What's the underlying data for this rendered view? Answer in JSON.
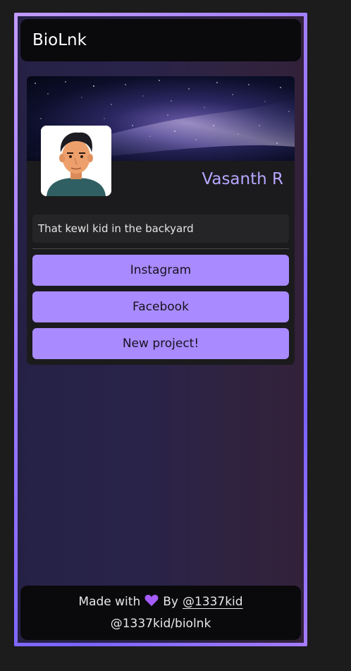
{
  "header": {
    "brand": "BioLnk"
  },
  "profile": {
    "name": "Vasanth R",
    "bio": "That kewl kid in the backyard"
  },
  "links": [
    {
      "label": "Instagram"
    },
    {
      "label": "Facebook"
    },
    {
      "label": "New project!"
    }
  ],
  "footer": {
    "made_with": "Made with",
    "heart_icon": "heart-icon",
    "by": "By",
    "author": "@1337kid",
    "repo": "@1337kid/biolnk"
  },
  "colors": {
    "accent": "#a98bff",
    "name": "#b7a6ff",
    "heart": "#a55cff"
  }
}
